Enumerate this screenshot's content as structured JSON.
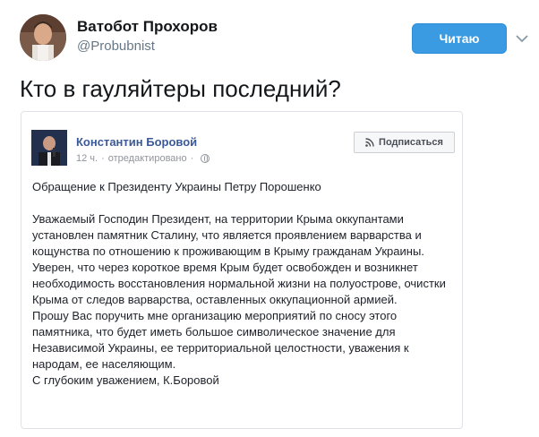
{
  "tweet": {
    "author_name": "Ватобот Прохоров",
    "author_handle": "@Probubnist",
    "follow_label": "Читаю",
    "text": "Кто в гауляйтеры последний?",
    "icons": {
      "avatar": "user-avatar",
      "caret": "chevron-down-icon"
    }
  },
  "embedded_post": {
    "author_name": "Константин Боровой",
    "time": "12 ч.",
    "edited": "отредактировано",
    "subscribe_label": "Подписаться",
    "heading": "Обращение к Президенту Украины Петру Порошенко",
    "paragraphs": [
      "Уважаемый Господин Президент, на территории Крыма оккупантами установлен памятник Сталину, что является проявлением варварства и кощунства по отношению к проживающим в Крыму гражданам Украины.",
      "Уверен, что через короткое время Крым будет освобожден и возникнет необходимость восстановления нормальной жизни на полуострове, очистки Крыма от следов варварства, оставленных оккупационной армией.",
      "Прошу Вас поручить мне организацию мероприятий по сносу этого памятника, что будет иметь большое символическое значение для Независимой Украины, ее территориальной целостности, уважения к народам, ее населяющим.",
      "С глубоким уважением, К.Боровой"
    ],
    "icons": {
      "globe": "globe-icon",
      "rss": "rss-icon"
    }
  },
  "colors": {
    "follow_button": "#3a9ae2",
    "fb_link": "#3b5998",
    "meta": "#90949c"
  }
}
